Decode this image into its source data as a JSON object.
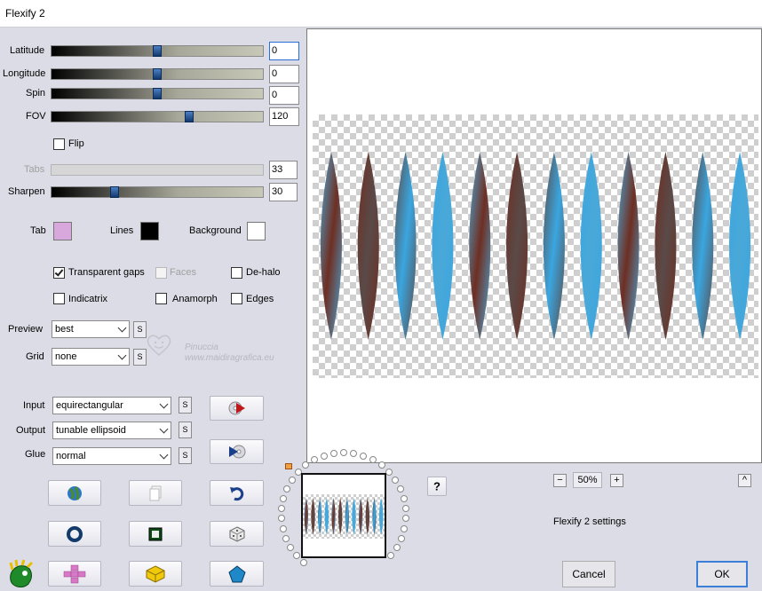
{
  "window": {
    "title": "Flexify 2"
  },
  "sliders": [
    {
      "label": "Latitude",
      "value": "0",
      "position": 0.5,
      "enabled": true
    },
    {
      "label": "Longitude",
      "value": "0",
      "position": 0.5,
      "enabled": true
    },
    {
      "label": "Spin",
      "value": "0",
      "position": 0.5,
      "enabled": true
    },
    {
      "label": "FOV",
      "value": "120",
      "position": 0.65,
      "enabled": true
    },
    {
      "label": "Tabs",
      "value": "33",
      "enabled": false
    },
    {
      "label": "Sharpen",
      "value": "30",
      "position": 0.3,
      "enabled": true
    }
  ],
  "flip": {
    "label": "Flip",
    "checked": false
  },
  "colors": {
    "tab": {
      "label": "Tab",
      "color": "#d8a8dc"
    },
    "lines": {
      "label": "Lines",
      "color": "#000000"
    },
    "background": {
      "label": "Background",
      "color": "#ffffff"
    }
  },
  "checkboxes": {
    "transparent_gaps": {
      "label": "Transparent gaps",
      "checked": true
    },
    "faces": {
      "label": "Faces",
      "checked": false,
      "enabled": false
    },
    "de_halo": {
      "label": "De-halo",
      "checked": false
    },
    "indicatrix": {
      "label": "Indicatrix",
      "checked": false
    },
    "anamorph": {
      "label": "Anamorph",
      "checked": false
    },
    "edges": {
      "label": "Edges",
      "checked": false
    }
  },
  "dropdowns": {
    "preview": {
      "label": "Preview",
      "value": "best"
    },
    "grid": {
      "label": "Grid",
      "value": "none"
    },
    "input": {
      "label": "Input",
      "value": "equirectangular"
    },
    "output": {
      "label": "Output",
      "value": "tunable ellipsoid"
    },
    "glue": {
      "label": "Glue",
      "value": "normal"
    }
  },
  "s_button_label": "S",
  "watermark": {
    "name": "Pinuccia",
    "url": "www.maidiragrafica.eu"
  },
  "preview_image": {
    "lens_colors": [
      "#4aa8d8",
      "#6e2e22",
      "#5a4a48",
      "#3aa6e0"
    ],
    "lens_count": 12
  },
  "zoom": {
    "minus": "−",
    "value": "50%",
    "plus": "+"
  },
  "help_label": "?",
  "collapse_label": "^",
  "settings_label": "Flexify 2 settings",
  "buttons": {
    "cancel": "Cancel",
    "ok": "OK"
  },
  "toolbar_icons": [
    "globe-icon",
    "copy-icon",
    "undo-icon",
    "ring-icon",
    "square-frame-icon",
    "dice-icon",
    "shuffle-icon",
    "cube-icon",
    "pentagon-icon"
  ]
}
